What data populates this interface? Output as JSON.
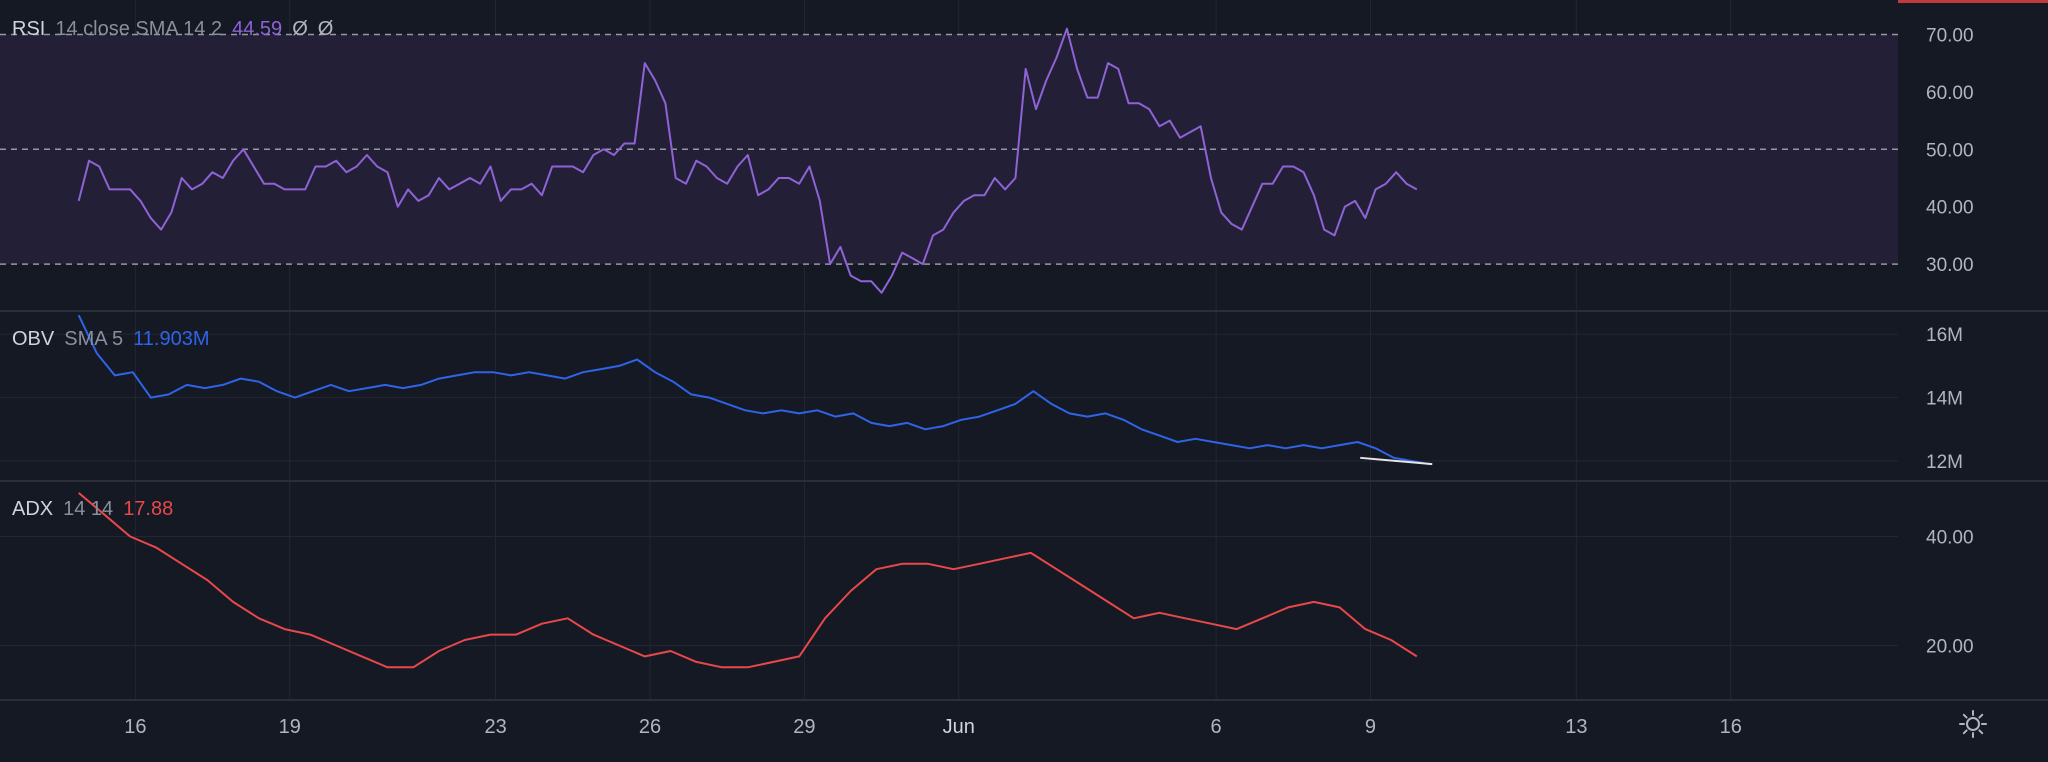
{
  "colors": {
    "background": "#151924",
    "grid": "#232733",
    "text": "#b2b5be",
    "rsi": "#8d63d6",
    "rsi_band": "#231f37",
    "obv": "#2f63e8",
    "adx": "#e8484a",
    "trendline": "#e6e6e6",
    "top_tab": "#c0393b"
  },
  "legends": {
    "rsi": {
      "name": "RSI",
      "params": "14 close SMA 14 2",
      "value": "44.59",
      "extra1": "Ø",
      "extra2": "Ø"
    },
    "obv": {
      "name": "OBV",
      "params": "SMA 5",
      "value": "11.903M"
    },
    "adx": {
      "name": "ADX",
      "params": "14 14",
      "value": "17.88"
    }
  },
  "settings_icon": "gear-icon",
  "chart_data": [
    {
      "type": "line",
      "name": "RSI",
      "y_ticks": [
        "70.00",
        "60.00",
        "50.00",
        "40.00",
        "30.00"
      ],
      "ylim": [
        22,
        76
      ],
      "bands": [
        30,
        70
      ],
      "midline": 50,
      "x": [
        0,
        0.2,
        0.4,
        0.6,
        0.8,
        1.0,
        1.2,
        1.4,
        1.6,
        1.8,
        2.0,
        2.2,
        2.4,
        2.6,
        2.8,
        3.0,
        3.2,
        3.4,
        3.6,
        3.8,
        4.0,
        4.2,
        4.4,
        4.6,
        4.8,
        5.0,
        5.2,
        5.4,
        5.6,
        5.8,
        6.0,
        6.2,
        6.4,
        6.6,
        6.8,
        7.0,
        7.2,
        7.4,
        7.6,
        7.8,
        8.0,
        8.2,
        8.4,
        8.6,
        8.8,
        9.0,
        9.2,
        9.4,
        9.6,
        9.8,
        10.0,
        10.2,
        10.4,
        10.6,
        10.8,
        11.0,
        11.2,
        11.4,
        11.6,
        11.8,
        12.0,
        12.2,
        12.4,
        12.6,
        12.8,
        13.0,
        13.2,
        13.4,
        13.6,
        13.8,
        14.0,
        14.2,
        14.4,
        14.6,
        14.8,
        15.0,
        15.2,
        15.4,
        15.6,
        15.8,
        16.0,
        16.2,
        16.4,
        16.6,
        16.8,
        17.0,
        17.2,
        17.4,
        17.6,
        17.8,
        18.0,
        18.2,
        18.4,
        18.6,
        18.8,
        19.0,
        19.2,
        19.4,
        19.6,
        19.8,
        20.0,
        20.2,
        20.4,
        20.6,
        20.8,
        21.0,
        21.2,
        21.4,
        21.6,
        21.8,
        22.0,
        22.2,
        22.4,
        22.6,
        22.8,
        23.0,
        23.2,
        23.4,
        23.6,
        23.8,
        24.0,
        24.2,
        24.4,
        24.6,
        24.8,
        25.0,
        25.2,
        25.4,
        25.6,
        25.8,
        26.0
      ],
      "values": [
        41,
        48,
        47,
        43,
        43,
        43,
        41,
        38,
        36,
        39,
        45,
        43,
        44,
        46,
        45,
        48,
        50,
        47,
        44,
        44,
        43,
        43,
        43,
        47,
        47,
        48,
        46,
        47,
        49,
        47,
        46,
        40,
        43,
        41,
        42,
        45,
        43,
        44,
        45,
        44,
        47,
        41,
        43,
        43,
        44,
        42,
        47,
        47,
        47,
        46,
        49,
        50,
        49,
        51,
        51,
        65,
        62,
        58,
        45,
        44,
        48,
        47,
        45,
        44,
        47,
        49,
        42,
        43,
        45,
        45,
        44,
        47,
        41,
        30,
        33,
        28,
        27,
        27,
        25,
        28,
        32,
        31,
        30,
        35,
        36,
        39,
        41,
        42,
        42,
        45,
        43,
        45,
        64,
        57,
        62,
        66,
        71,
        64,
        59,
        59,
        65,
        64,
        58,
        58,
        57,
        54,
        55,
        52,
        53,
        54,
        45,
        39,
        37,
        36,
        40,
        44,
        44,
        47,
        47,
        46,
        42,
        36,
        35,
        40,
        41,
        38,
        43,
        44,
        46,
        44,
        43,
        45
      ]
    },
    {
      "type": "line",
      "name": "OBV",
      "y_ticks": [
        "16M",
        "14M",
        "12M"
      ],
      "ylim": [
        11.4,
        16.7
      ],
      "x": [
        0,
        0.35,
        0.7,
        1.05,
        1.4,
        1.75,
        2.1,
        2.45,
        2.8,
        3.15,
        3.5,
        3.85,
        4.2,
        4.55,
        4.9,
        5.25,
        5.6,
        5.95,
        6.3,
        6.65,
        7.0,
        7.35,
        7.7,
        8.05,
        8.4,
        8.75,
        9.1,
        9.45,
        9.8,
        10.15,
        10.5,
        10.85,
        11.2,
        11.55,
        11.9,
        12.25,
        12.6,
        12.95,
        13.3,
        13.65,
        14.0,
        14.35,
        14.7,
        15.05,
        15.4,
        15.75,
        16.1,
        16.45,
        16.8,
        17.15,
        17.5,
        17.85,
        18.2,
        18.55,
        18.9,
        19.25,
        19.6,
        19.95,
        20.3,
        20.65,
        21.0,
        21.35,
        21.7,
        22.05,
        22.4,
        22.75,
        23.1,
        23.45,
        23.8,
        24.15,
        24.5,
        24.85,
        25.2,
        25.55,
        25.9,
        26.25
      ],
      "values": [
        16.6,
        15.4,
        14.7,
        14.8,
        14.0,
        14.1,
        14.4,
        14.3,
        14.4,
        14.6,
        14.5,
        14.2,
        14.0,
        14.2,
        14.4,
        14.2,
        14.3,
        14.4,
        14.3,
        14.4,
        14.6,
        14.7,
        14.8,
        14.8,
        14.7,
        14.8,
        14.7,
        14.6,
        14.8,
        14.9,
        15.0,
        15.2,
        14.8,
        14.5,
        14.1,
        14.0,
        13.8,
        13.6,
        13.5,
        13.6,
        13.5,
        13.6,
        13.4,
        13.5,
        13.2,
        13.1,
        13.2,
        13.0,
        13.1,
        13.3,
        13.4,
        13.6,
        13.8,
        14.2,
        13.8,
        13.5,
        13.4,
        13.5,
        13.3,
        13.0,
        12.8,
        12.6,
        12.7,
        12.6,
        12.5,
        12.4,
        12.5,
        12.4,
        12.5,
        12.4,
        12.5,
        12.6,
        12.4,
        12.1,
        12.0,
        11.9
      ]
    },
    {
      "type": "line",
      "name": "ADX",
      "y_ticks": [
        "40.00",
        "20.00"
      ],
      "ylim": [
        10,
        50
      ],
      "x": [
        0,
        0.5,
        1.0,
        1.5,
        2.0,
        2.5,
        3.0,
        3.5,
        4.0,
        4.5,
        5.0,
        5.5,
        6.0,
        6.5,
        7.0,
        7.5,
        8.0,
        8.5,
        9.0,
        9.5,
        10.0,
        10.5,
        11.0,
        11.5,
        12.0,
        12.5,
        13.0,
        13.5,
        14.0,
        14.5,
        15.0,
        15.5,
        16.0,
        16.5,
        17.0,
        17.5,
        18.0,
        18.5,
        19.0,
        19.5,
        20.0,
        20.5,
        21.0,
        21.5,
        22.0,
        22.5,
        23.0,
        23.5,
        24.0,
        24.5,
        25.0,
        25.5,
        26.0
      ],
      "values": [
        48,
        44,
        40,
        38,
        35,
        32,
        28,
        25,
        23,
        22,
        20,
        18,
        16,
        16,
        19,
        21,
        22,
        22,
        24,
        25,
        22,
        20,
        18,
        19,
        17,
        16,
        16,
        17,
        18,
        25,
        30,
        34,
        35,
        35,
        34,
        35,
        36,
        37,
        34,
        31,
        28,
        25,
        26,
        25,
        24,
        23,
        25,
        27,
        28,
        27,
        23,
        21,
        18
      ]
    }
  ],
  "x_axis": {
    "ticks": [
      {
        "label": "16",
        "x": 1.1
      },
      {
        "label": "19",
        "x": 4.1
      },
      {
        "label": "23",
        "x": 8.1
      },
      {
        "label": "26",
        "x": 11.1
      },
      {
        "label": "29",
        "x": 14.1
      },
      {
        "label": "Jun",
        "x": 17.1
      },
      {
        "label": "6",
        "x": 22.1
      },
      {
        "label": "9",
        "x": 25.1
      },
      {
        "label": "13",
        "x": 29.1
      },
      {
        "label": "16",
        "x": 32.1
      }
    ],
    "xlim": [
      -1.53,
      35.35
    ]
  },
  "trendline": {
    "x": [
      24.9,
      26.3
    ],
    "values": [
      12.1,
      11.9
    ]
  }
}
